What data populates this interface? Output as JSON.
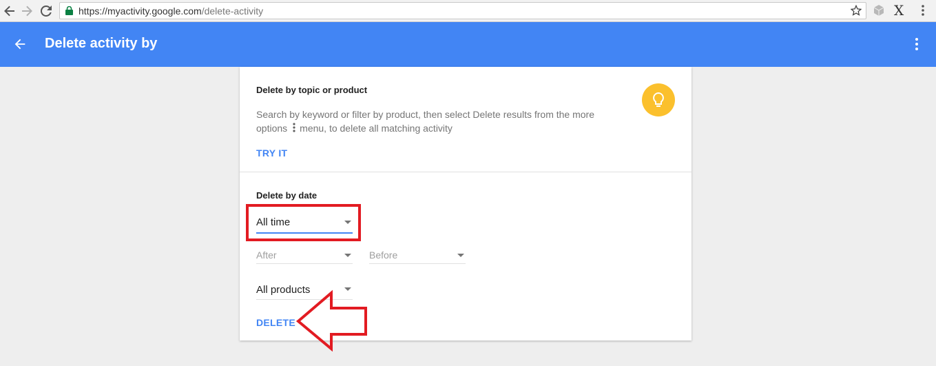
{
  "browser": {
    "url_host": "https://myactivity.google.com",
    "url_path": "/delete-activity",
    "extension_label": "X"
  },
  "app_bar": {
    "title": "Delete activity by",
    "color": "#4285f4"
  },
  "topic_section": {
    "title": "Delete by topic or product",
    "description_part1": "Search by keyword or filter by product, then select Delete results from the more options",
    "description_part2": "menu, to delete all matching activity",
    "action_label": "TRY IT",
    "icon": "lightbulb-icon"
  },
  "date_section": {
    "title": "Delete by date",
    "range_select": {
      "value": "All time"
    },
    "after_select": {
      "placeholder": "After"
    },
    "before_select": {
      "placeholder": "Before"
    },
    "products_select": {
      "value": "All products"
    },
    "action_label": "DELETE"
  },
  "colors": {
    "accent": "#4285f4",
    "bulb": "#fbc02d",
    "annotation": "#e21b22"
  }
}
